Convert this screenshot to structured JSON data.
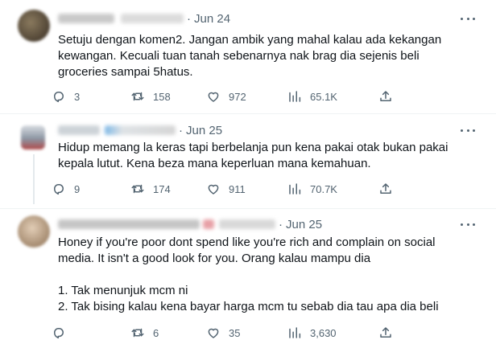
{
  "tweets": [
    {
      "date": "Jun 24",
      "text": "Setuju dengan komen2. Jangan ambik yang mahal kalau ada kekangan\nkewangan. Kecuali tuan tanah sebenarnya nak brag dia sejenis beli\ngroceries sampai 5hatus.",
      "replies": "3",
      "retweets": "158",
      "likes": "972",
      "views": "65.1K",
      "avatar_color": "#6b5a44"
    },
    {
      "date": "Jun 25",
      "text": "Hidup memang la keras tapi berbelanja pun kena pakai otak bukan pakai\nkepala lutut. Kena beza mana keperluan mana kemahuan.",
      "replies": "9",
      "retweets": "174",
      "likes": "911",
      "views": "70.7K",
      "avatar_color": "#9aa3ad"
    },
    {
      "date": "Jun 25",
      "text": "Honey if you're poor dont spend like you're rich and complain on social\nmedia. It isn't a good look for you. Orang kalau mampu dia\n\n1. Tak menunjuk mcm ni\n2. Tak bising kalau kena bayar harga mcm tu sebab dia tau apa dia beli",
      "replies": "",
      "retweets": "6",
      "likes": "35",
      "views": "3,630",
      "avatar_color": "#b8a48f"
    }
  ],
  "icons": {
    "reply": "reply-icon",
    "retweet": "retweet-icon",
    "like": "heart-icon",
    "views": "views-icon",
    "share": "share-icon",
    "more": "more-icon"
  }
}
